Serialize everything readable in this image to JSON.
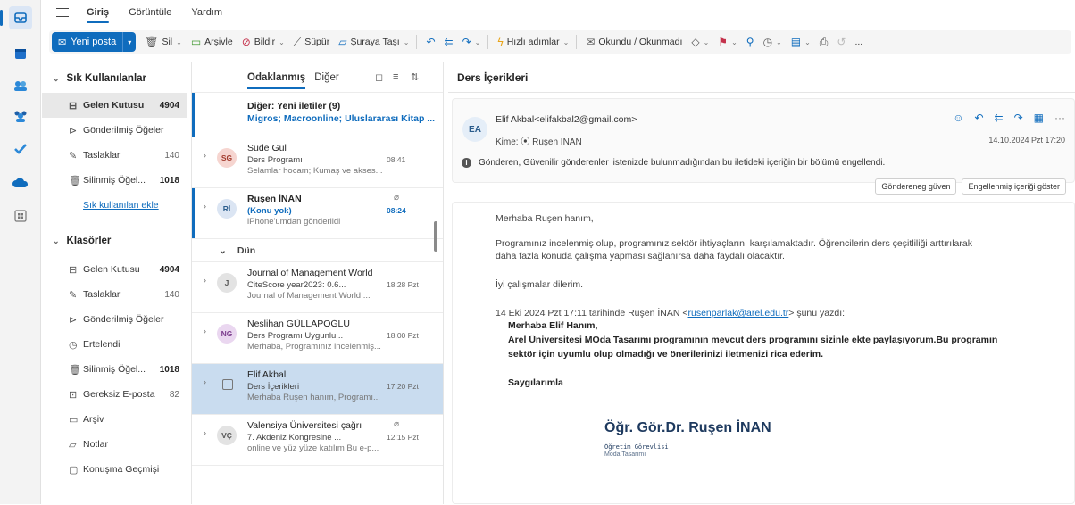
{
  "menu": {
    "tabs": [
      "Giriş",
      "Görüntüle",
      "Yardım"
    ]
  },
  "toolbar": {
    "new_mail": "Yeni posta",
    "delete": "Sil",
    "archive": "Arşivle",
    "report": "Bildir",
    "sweep": "Süpür",
    "move": "Şuraya Taşı",
    "quick": "Hızlı adımlar",
    "read_unread": "Okundu / Okunmadı",
    "more": "..."
  },
  "folders": {
    "favorites_title": "Sık Kullanılanlar",
    "favorites": [
      {
        "label": "Gelen Kutusu",
        "count": "4904",
        "icon": "inbox-icon"
      },
      {
        "label": "Gönderilmiş Öğeler",
        "count": "",
        "icon": "sent-icon"
      },
      {
        "label": "Taslaklar",
        "count": "140",
        "icon": "draft-icon"
      },
      {
        "label": "Silinmiş Öğel...",
        "count": "1018",
        "icon": "trash-icon"
      }
    ],
    "add_favorite": "Sık kullanılan ekle",
    "folders_title": "Klasörler",
    "folders": [
      {
        "label": "Gelen Kutusu",
        "count": "4904",
        "icon": "inbox-icon"
      },
      {
        "label": "Taslaklar",
        "count": "140",
        "icon": "draft-icon"
      },
      {
        "label": "Gönderilmiş Öğeler",
        "count": "",
        "icon": "sent-icon"
      },
      {
        "label": "Ertelendi",
        "count": "",
        "icon": "clock-icon"
      },
      {
        "label": "Silinmiş Öğel...",
        "count": "1018",
        "icon": "trash-icon"
      },
      {
        "label": "Gereksiz E-posta",
        "count": "82",
        "icon": "junk-icon"
      },
      {
        "label": "Arşiv",
        "count": "",
        "icon": "archive-icon"
      },
      {
        "label": "Notlar",
        "count": "",
        "icon": "note-icon"
      },
      {
        "label": "Konuşma Geçmişi",
        "count": "",
        "icon": "folder-icon"
      }
    ]
  },
  "list": {
    "tab_focused": "Odaklanmış",
    "tab_other": "Diğer",
    "other_title": "Diğer: Yeni iletiler (9)",
    "other_senders": "Migros; Macroonline; Uluslararası Kitap ...",
    "day_header": "Dün",
    "messages": [
      {
        "initials": "SG",
        "from": "Sude Gül",
        "subject": "Ders Programı",
        "preview": "Selamlar hocam; Kumaş ve akses...",
        "time": "08:41",
        "avatar_bg": "#f6d5d0",
        "avatar_fg": "#a33b2e"
      },
      {
        "initials": "Rİ",
        "from": "Ruşen İNAN",
        "subject": "(Konu yok)",
        "preview": "iPhone'umdan gönderildi",
        "time": "08:24",
        "avatar_bg": "#dbe5f3",
        "avatar_fg": "#2a5c8c"
      },
      {
        "initials": "J",
        "from": "Journal of Management World",
        "subject": "CiteScore year2023: 0.6...",
        "preview": "Journal of Management World ...",
        "time": "18:28 Pzt",
        "avatar_bg": "#e3e3e3",
        "avatar_fg": "#555"
      },
      {
        "initials": "NG",
        "from": "Neslihan GÜLLAPOĞLU",
        "subject": "Ders Programı Uygunlu...",
        "preview": "Merhaba, Programınız incelenmiş...",
        "time": "18:00 Pzt",
        "avatar_bg": "#ead7f0",
        "avatar_fg": "#7a3b8c"
      },
      {
        "initials": "",
        "from": "Elif Akbal",
        "subject": "Ders İçerikleri",
        "preview": "Merhaba Ruşen hanım, Programı...",
        "time": "17:20 Pzt",
        "avatar_bg": "",
        "avatar_fg": ""
      },
      {
        "initials": "VÇ",
        "from": "Valensiya Üniversitesi çağrı",
        "subject": "7. Akdeniz Kongresine ...",
        "preview": "online ve yüz yüze katılım Bu e-p...",
        "time": "12:15 Pzt",
        "avatar_bg": "#e3e3e3",
        "avatar_fg": "#555"
      }
    ]
  },
  "reading": {
    "title": "Ders İçerikleri",
    "initials": "EA",
    "sender": "Elif Akbal<elifakbal2@gmail.com>",
    "to": "Kime: ⦿ Ruşen İNAN",
    "date": "14.10.2024 Pzt 17:20",
    "warning": "Gönderen, Güvenilir gönderenler listenizde bulunmadığından bu iletideki içeriğin bir bölümü engellendi.",
    "trust_btn": "Göndereneg güven",
    "show_btn": "Engellenmiş içeriği göster",
    "greeting": "Merhaba Ruşen hanım,",
    "para1": "Programınız incelenmiş olup, programınız sektör ihtiyaçlarını karşılamaktadır.  Öğrencilerin ders çeşitliliği arttırılarak",
    "para2": "daha fazla konuda çalışma yapması sağlanırsa daha faydalı olacaktır.",
    "closing": "İyi çalışmalar dilerim.",
    "quote_pre": "14 Eki 2024 Pzt 17:11 tarihinde Ruşen İNAN <",
    "quote_link": "rusenparlak@arel.edu.tr",
    "quote_post": "> şunu yazdı:",
    "q1": "Merhaba Elif Hanım,",
    "q2": "Arel Üniversitesi MOda Tasarımı programının mevcut ders programını sizinle ekte paylaşıyorum.Bu programın",
    "q3": "sektör için uyumlu olup olmadığı ve önerilerinizi iletmenizi rica ederim.",
    "q4": "Saygılarımla",
    "sig_name": "Öğr. Gör.Dr. Ruşen İNAN",
    "sig_title": "Öğretim Görevlisi",
    "sig_dept": "Moda Tasarımı"
  }
}
